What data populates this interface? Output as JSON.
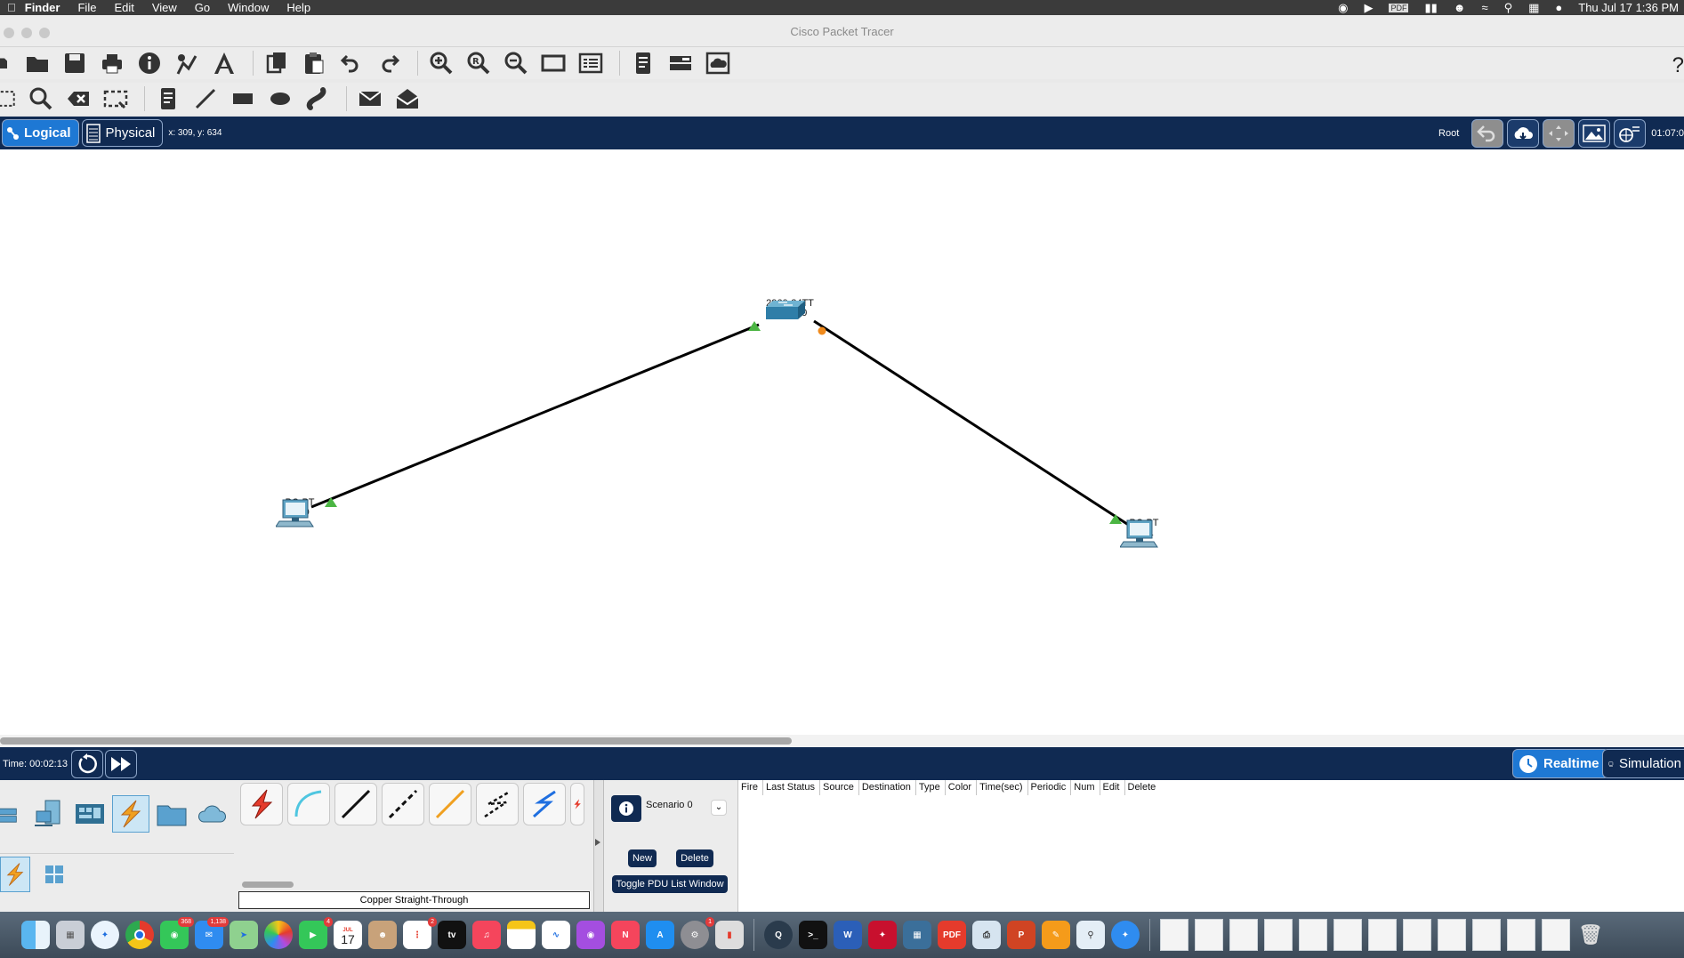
{
  "menubar": {
    "app_name": "Finder",
    "items": [
      "File",
      "Edit",
      "View",
      "Go",
      "Window",
      "Help"
    ],
    "clock": "Thu Jul 17  1:36 PM"
  },
  "window": {
    "title": "Cisco Packet Tracer"
  },
  "navbar": {
    "logical_label": "Logical",
    "physical_label": "Physical",
    "coords": "x: 309, y: 634",
    "root_label": "Root",
    "clock": "01:07:0"
  },
  "canvas": {
    "switch": {
      "model": "2960-24TT",
      "name": "Switch0"
    },
    "pc0": {
      "model": "PC-PT",
      "name": "PC0"
    },
    "pc1": {
      "model": "PC-PT",
      "name": "PC1"
    }
  },
  "simbar": {
    "time": "Time: 00:02:13",
    "realtime_label": "Realtime",
    "simulation_label": "Simulation"
  },
  "bottom": {
    "cable_label": "Copper Straight-Through",
    "scenario": "Scenario 0",
    "new_label": "New",
    "delete_label": "Delete",
    "toggle_label": "Toggle PDU List Window",
    "pdu_columns": [
      "Fire",
      "Last Status",
      "Source",
      "Destination",
      "Type",
      "Color",
      "Time(sec)",
      "Periodic",
      "Num",
      "Edit",
      "Delete"
    ]
  },
  "dock": {
    "badges": {
      "messages": "368",
      "mail": "1,138",
      "facetime": "4",
      "reminders": "2",
      "settings": "1"
    },
    "calendar": {
      "month": "JUL",
      "day": "17"
    }
  },
  "colors": {
    "navy": "#102a52",
    "accent_blue": "#1e78d4",
    "link_up": "#4bb543",
    "link_pending": "#f08a1c"
  }
}
